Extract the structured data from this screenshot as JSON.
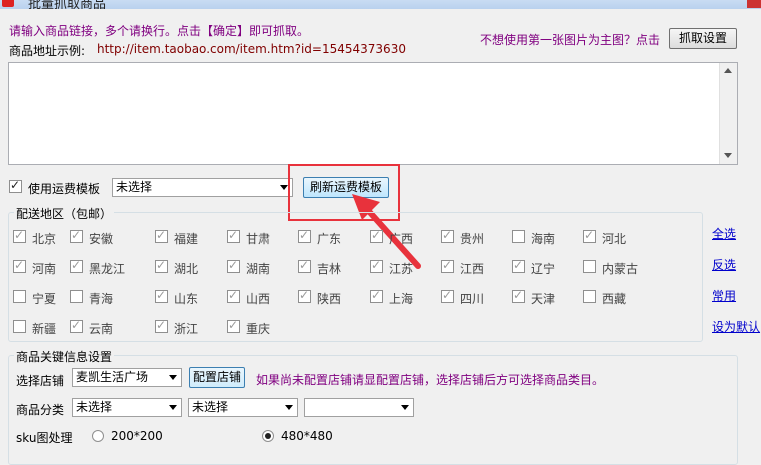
{
  "window": {
    "title": "批量抓取商品"
  },
  "instructions": {
    "line1": "请输入商品链接，多个请换行。点击【确定】即可抓取。",
    "example_label": "商品地址示例:",
    "example_url": "http://item.taobao.com/item.htm?id=15454373630",
    "main_image_hint": "不想使用第一张图片为主图？点击",
    "settings_button": "抓取设置"
  },
  "url_input": {
    "value": ""
  },
  "shipping": {
    "use_template_label": "使用运费模板",
    "use_template_checked": true,
    "template_select": "未选择",
    "refresh_button": "刷新运费模板"
  },
  "regions": {
    "legend": "配送地区（包邮）",
    "items": [
      {
        "name": "北京",
        "checked": true
      },
      {
        "name": "安徽",
        "checked": true
      },
      {
        "name": "福建",
        "checked": true
      },
      {
        "name": "甘肃",
        "checked": true
      },
      {
        "name": "广东",
        "checked": true
      },
      {
        "name": "广西",
        "checked": true
      },
      {
        "name": "贵州",
        "checked": true
      },
      {
        "name": "海南",
        "checked": false
      },
      {
        "name": "河北",
        "checked": true
      },
      {
        "name": "河南",
        "checked": true
      },
      {
        "name": "黑龙江",
        "checked": true
      },
      {
        "name": "湖北",
        "checked": true
      },
      {
        "name": "湖南",
        "checked": true
      },
      {
        "name": "吉林",
        "checked": true
      },
      {
        "name": "江苏",
        "checked": true
      },
      {
        "name": "江西",
        "checked": true
      },
      {
        "name": "辽宁",
        "checked": true
      },
      {
        "name": "内蒙古",
        "checked": false
      },
      {
        "name": "宁夏",
        "checked": false
      },
      {
        "name": "青海",
        "checked": false
      },
      {
        "name": "山东",
        "checked": true
      },
      {
        "name": "山西",
        "checked": true
      },
      {
        "name": "陕西",
        "checked": true
      },
      {
        "name": "上海",
        "checked": true
      },
      {
        "name": "四川",
        "checked": true
      },
      {
        "name": "天津",
        "checked": true
      },
      {
        "name": "西藏",
        "checked": false
      },
      {
        "name": "新疆",
        "checked": false
      },
      {
        "name": "云南",
        "checked": true
      },
      {
        "name": "浙江",
        "checked": true
      },
      {
        "name": "重庆",
        "checked": true
      }
    ],
    "actions": [
      "全选",
      "反选",
      "常用",
      "设为默认"
    ]
  },
  "key_info": {
    "legend": "商品关键信息设置",
    "store_label": "选择店铺",
    "store_select": "麦凯生活广场",
    "config_store_button": "配置店铺",
    "store_hint": "如果尚未配置店铺请显配置店铺，选择店铺后方可选择商品类目。",
    "category_label": "商品分类",
    "category_select1": "未选择",
    "category_select2": "未选择",
    "category_select3": "",
    "sku_label": "sku图处理",
    "sku_option1": "200*200",
    "sku_option2": "480*480",
    "sku_selected": "480*480"
  },
  "colors": {
    "annotation": "#e8323c",
    "hint": "#800080",
    "url": "#800000",
    "link": "#0000cc"
  }
}
